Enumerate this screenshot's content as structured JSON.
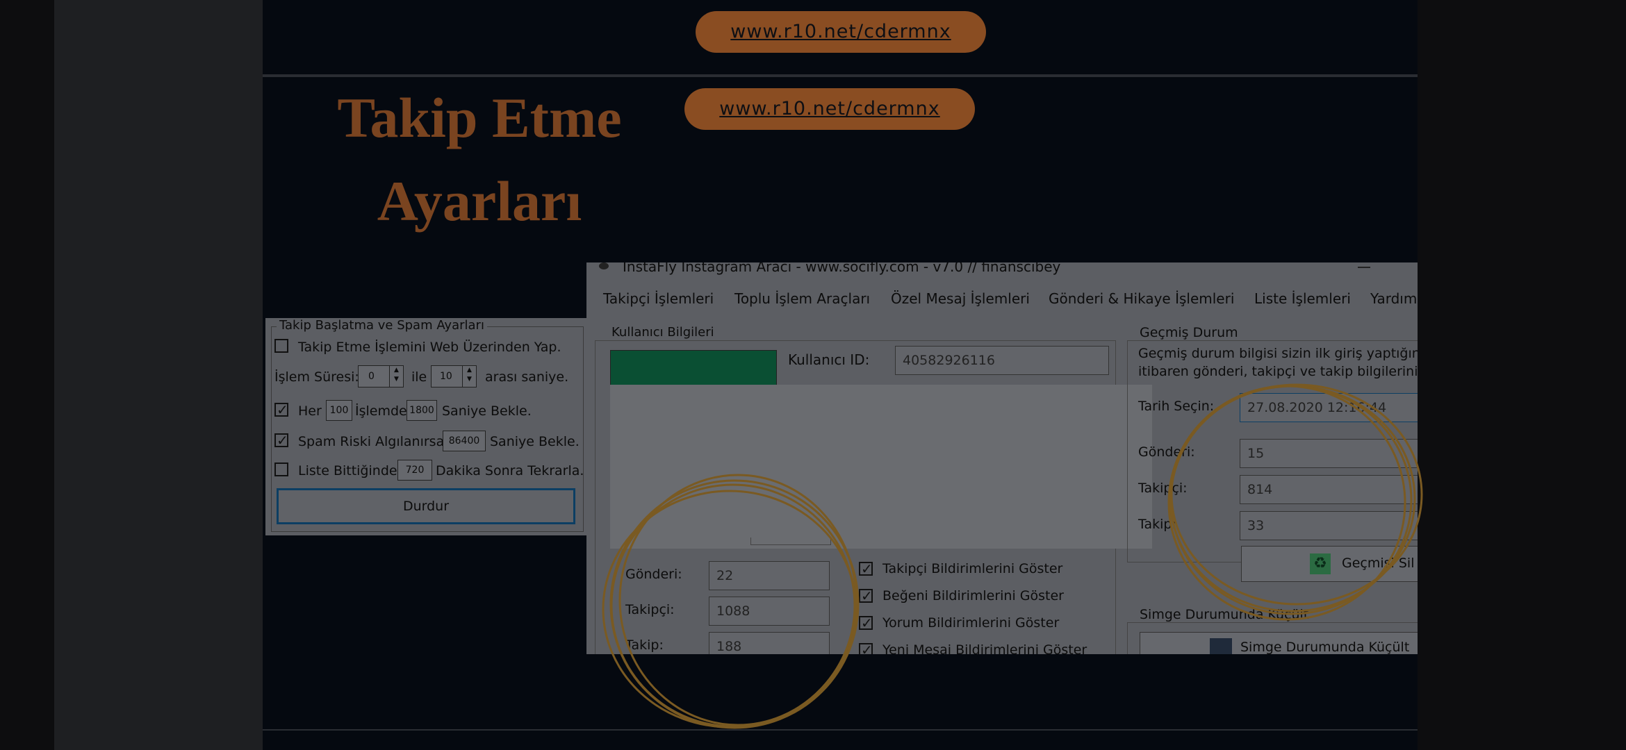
{
  "banner_links": [
    "www.r10.net/cdermnx",
    "www.r10.net/cdermnx"
  ],
  "heading": {
    "line1": "Takip Etme",
    "line2": "Ayarları"
  },
  "spam_panel": {
    "title": "Takip Başlatma ve Spam Ayarları",
    "web_option": "Takip Etme İşlemini Web Üzerinden Yap.",
    "islem_suresi_label": "İşlem Süresi:",
    "min_value": "0",
    "ile_label": "ile",
    "max_value": "10",
    "arasi_label": "arası saniye.",
    "her_label": "Her",
    "her_value": "100",
    "islemde_label": "İşlemde",
    "wait_value": "1800",
    "saniye_bekle_label": "Saniye Bekle.",
    "spam_label": "Spam Riski Algılanırsa",
    "spam_value": "86400",
    "spam_suffix": "Saniye Bekle.",
    "liste_label": "Liste Bittiğinde",
    "liste_value": "720",
    "liste_suffix": "Dakika Sonra Tekrarla.",
    "durdur_label": "Durdur"
  },
  "app": {
    "title": "InstaFly Instagram Aracı - www.socifly.com - v7.0 // finanscibey",
    "menu": [
      "Takipçi İşlemleri",
      "Toplu İşlem Araçları",
      "Özel Mesaj İşlemleri",
      "Gönderi & Hikaye İşlemleri",
      "Liste İşlemleri",
      "Yardım"
    ],
    "user_group": "Kullanıcı Bilgileri",
    "user_id_label": "Kullanıcı ID:",
    "user_id_value": "40582926116",
    "gonderi_label": "Gönderi:",
    "gonderi_value": "22",
    "takipci_label": "Takipçi:",
    "takipci_value": "1088",
    "takip_label": "Takip:",
    "takip_value": "188",
    "notifications": [
      "Takipçi Bildirimlerini Göster",
      "Beğeni Bildirimlerini Göster",
      "Yorum Bildirimlerini Göster",
      "Yeni Mesaj Bildirimlerini Göster"
    ],
    "history_group": "Geçmiş Durum",
    "history_desc1": "Geçmiş durum bilgisi sizin ilk giriş yaptığın",
    "history_desc2": "itibaren gönderi, takipçi ve takip bilgilerini",
    "date_label": "Tarih Seçin:",
    "date_value": "27.08.2020 12:16:44",
    "h_gonderi_label": "Gönderi:",
    "h_gonderi_value": "15",
    "h_takipci_label": "Takipçi:",
    "h_takipci_value": "814",
    "h_takip_label": "Takip:",
    "h_takip_value": "33",
    "clear_history": "Geçmişi Sil",
    "minimize_group": "Simge Durumunda Küçült",
    "minimize_button": "Simge Durumunda Küçült"
  },
  "colors": {
    "accent": "#8a4d22",
    "title": "#7a4420",
    "ring": "#7a5a22",
    "avatar": "#0a4f33"
  }
}
